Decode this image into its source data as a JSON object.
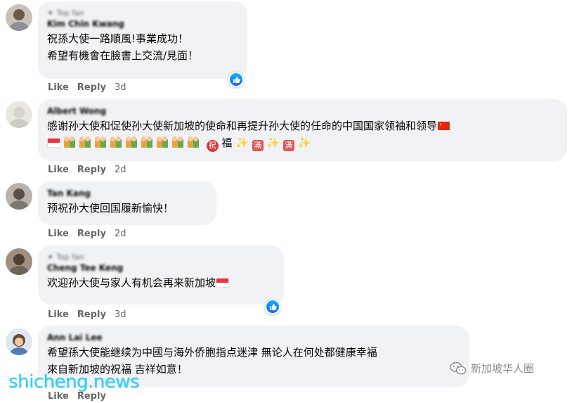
{
  "comments": [
    {
      "badge": "Top fan",
      "name": "Kim Chin Kwang",
      "lines": [
        "祝孫大使一路順風!事業成功！",
        "希望有機會在臉書上交流/見面！"
      ],
      "like_label": "Like",
      "reply_label": "Reply",
      "time": "3d"
    },
    {
      "name": "Albert Wong",
      "lines": [
        "感谢孙大使和促使孙大使新加坡的使命和再提升孙大使的任命的中国国家领袖和领导"
      ],
      "emoji_line": {
        "fu": "福",
        "zhu": "祝",
        "man": "滿"
      },
      "like_label": "Like",
      "reply_label": "Reply",
      "time": "2d"
    },
    {
      "name": "Tan Kang",
      "lines": [
        "预祝孙大使回国履新愉快！"
      ],
      "like_label": "Like",
      "reply_label": "Reply",
      "time": "2d"
    },
    {
      "badge": "Top fan",
      "name": "Cheng Tee Keng",
      "lines": [
        "欢迎孙大使与家人有机会再来新加坡"
      ],
      "like_label": "Like",
      "reply_label": "Reply",
      "time": "3d"
    },
    {
      "name": "Ann Lai Lee",
      "lines": [
        "希望孫大使能继续为中國与海外侨胞指点迷津 無论人在何处都健康幸福",
        "來自新加坡的祝福 吉祥如意！"
      ],
      "like_label": "Like",
      "reply_label": "Reply"
    }
  ],
  "watermark": "shicheng.news",
  "wechat_account": "新加坡华人圈",
  "colors": {
    "bubble": "#f0f2f5",
    "meta": "#65676b",
    "like_blue": "#0866ff",
    "watermark": "#1fd4ff"
  }
}
